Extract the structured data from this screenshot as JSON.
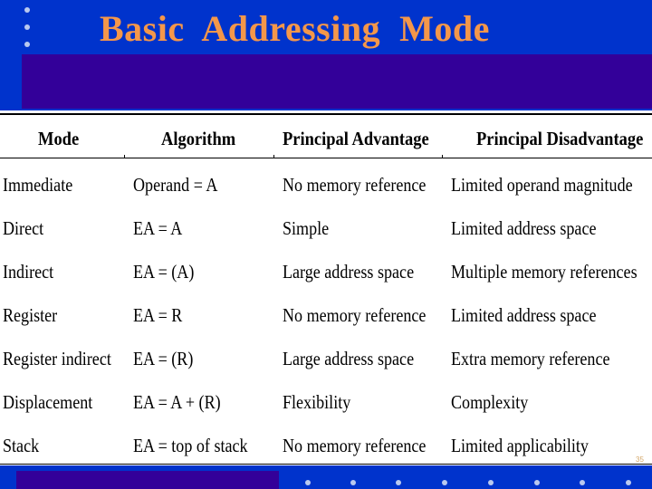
{
  "slide": {
    "title": "Basic  Addressing  Mode",
    "page_number": "35",
    "colors": {
      "background_blue": "#0033cc",
      "band_purple": "#330099",
      "title_orange": "#f4974a",
      "dot_color": "#b9c9ef"
    }
  },
  "table": {
    "headers": [
      "Mode",
      "Algorithm",
      "Principal Advantage",
      "Principal Disadvantage"
    ],
    "rows": [
      [
        "Immediate",
        "Operand = A",
        "No memory reference",
        "Limited operand magnitude"
      ],
      [
        "Direct",
        "EA = A",
        "Simple",
        "Limited address space"
      ],
      [
        "Indirect",
        "EA = (A)",
        "Large address space",
        "Multiple memory references"
      ],
      [
        "Register",
        "EA = R",
        "No memory reference",
        "Limited address space"
      ],
      [
        "Register indirect",
        "EA = (R)",
        "Large address space",
        "Extra memory reference"
      ],
      [
        "Displacement",
        "EA = A + (R)",
        "Flexibility",
        "Complexity"
      ],
      [
        "Stack",
        "EA = top of stack",
        "No memory reference",
        "Limited applicability"
      ]
    ]
  }
}
